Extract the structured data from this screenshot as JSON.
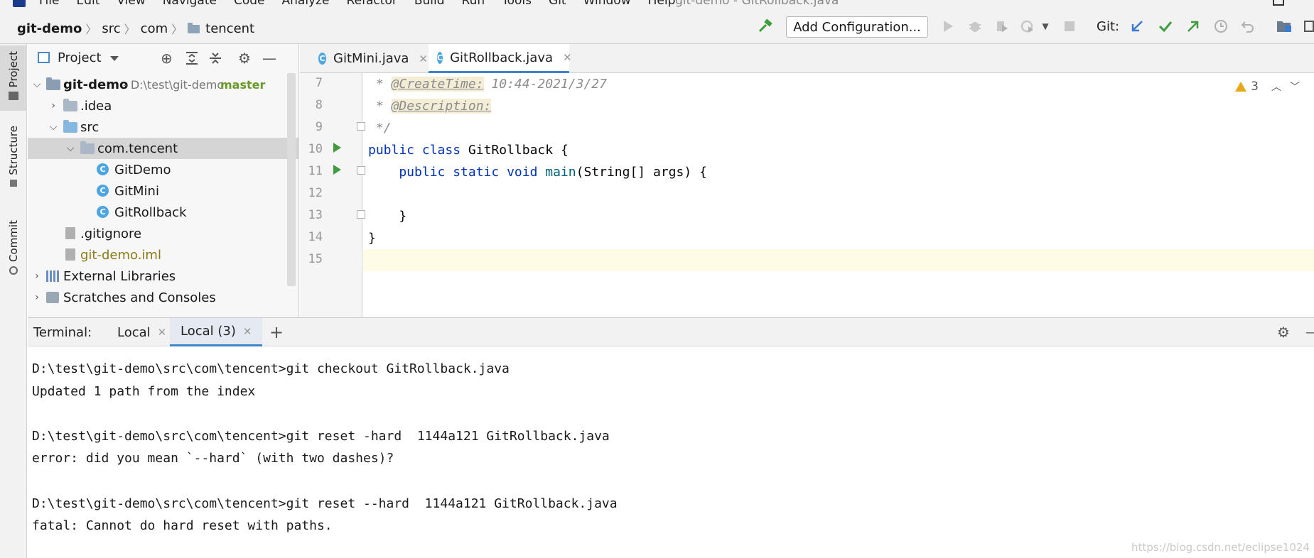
{
  "menu": {
    "items": [
      "File",
      "Edit",
      "View",
      "Navigate",
      "Code",
      "Analyze",
      "Refactor",
      "Build",
      "Run",
      "Tools",
      "Git",
      "Window",
      "Help"
    ],
    "window_title": "git-demo - GitRollback.java"
  },
  "breadcrumb": [
    "git-demo",
    "src",
    "com",
    "tencent"
  ],
  "toolbar": {
    "add_configuration": "Add Configuration...",
    "git_label": "Git:"
  },
  "left_stripe": [
    "Project",
    "Structure",
    "Commit"
  ],
  "project_panel": {
    "title": "Project",
    "root": {
      "name": "git-demo",
      "path": "- D:\\test\\git-demo",
      "branch": "master"
    },
    "items": [
      {
        "label": ".idea"
      },
      {
        "label": "src"
      },
      {
        "label": "com.tencent"
      },
      {
        "label": "GitDemo"
      },
      {
        "label": "GitMini"
      },
      {
        "label": "GitRollback"
      },
      {
        "label": ".gitignore"
      },
      {
        "label": "git-demo.iml"
      },
      {
        "label": "External Libraries"
      },
      {
        "label": "Scratches and Consoles"
      }
    ]
  },
  "editor": {
    "tabs": [
      "GitMini.java",
      "GitRollback.java"
    ],
    "active_tab": "GitRollback.java",
    "warnings": "3",
    "lines": [
      {
        "num": "7",
        "prefix": " * ",
        "tag": "@CreateTime:",
        "rest": " 10:44-2021/3/27"
      },
      {
        "num": "8",
        "prefix": " * ",
        "tag": "@Description:",
        "rest": ""
      },
      {
        "num": "9",
        "text": " */"
      },
      {
        "num": "10",
        "kw": "public class ",
        "name": "GitRollback",
        "rest": " {"
      },
      {
        "num": "11",
        "kw": "    public static void ",
        "fn": "main",
        "rest": "(String[] args) {"
      },
      {
        "num": "12",
        "text": ""
      },
      {
        "num": "13",
        "text": "    }"
      },
      {
        "num": "14",
        "text": "}"
      },
      {
        "num": "15",
        "text": ""
      }
    ]
  },
  "terminal": {
    "label": "Terminal:",
    "tabs": [
      "Local",
      "Local (3)"
    ],
    "active_tab": "Local (3)",
    "lines": [
      "D:\\test\\git-demo\\src\\com\\tencent>git checkout GitRollback.java",
      "Updated 1 path from the index",
      "",
      "D:\\test\\git-demo\\src\\com\\tencent>git reset -hard  1144a121 GitRollback.java",
      "error: did you mean `--hard` (with two dashes)?",
      "",
      "D:\\test\\git-demo\\src\\com\\tencent>git reset --hard  1144a121 GitRollback.java",
      "fatal: Cannot do hard reset with paths."
    ]
  },
  "watermark": "https://blog.csdn.net/eclipse1024",
  "colors": {
    "accent": "#4083c9",
    "run_green": "#3f9c3f",
    "keyword": "#0033b3",
    "branch": "#6a9a2a",
    "iml_file": "#8a7a1a"
  }
}
